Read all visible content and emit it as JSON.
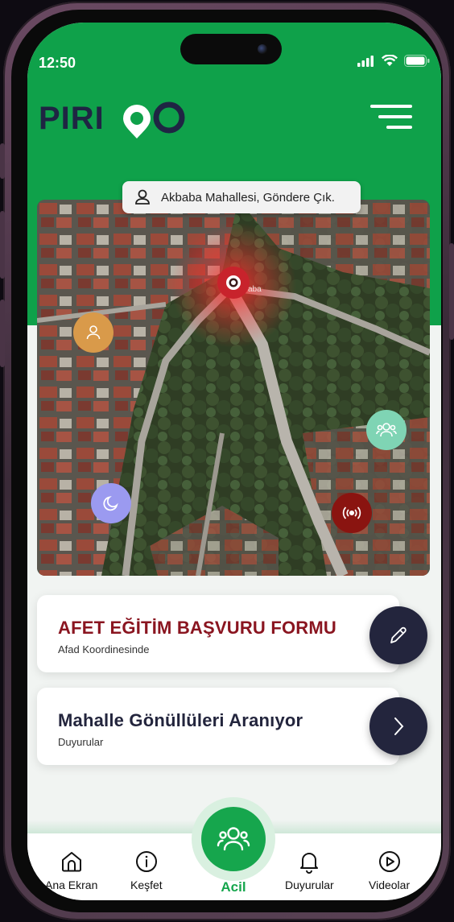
{
  "status_bar": {
    "time": "12:50"
  },
  "header": {
    "logo_text": "PIRIGO"
  },
  "map": {
    "address": "Akbaba Mahallesi, Göndere Çık.",
    "poi_label": "aba"
  },
  "cards": [
    {
      "title": "AFET EĞİTİM BAŞVURU FORMU",
      "subtitle": "Afad Koordinesinde",
      "title_color": "#8a1520",
      "action_icon": "pencil-icon"
    },
    {
      "title": "Mahalle Gönüllüleri Aranıyor",
      "subtitle": "Duyurular",
      "title_color": "#23253d",
      "action_icon": "chevron-right-icon"
    }
  ],
  "nav": {
    "home": "Ana Ekran",
    "explore": "Keşfet",
    "emergency": "Acil",
    "announcements": "Duyurular",
    "videos": "Videolar"
  },
  "colors": {
    "primary_green": "#0fa14a",
    "dark_navy": "#23253d",
    "alert_red": "#8a1520"
  }
}
